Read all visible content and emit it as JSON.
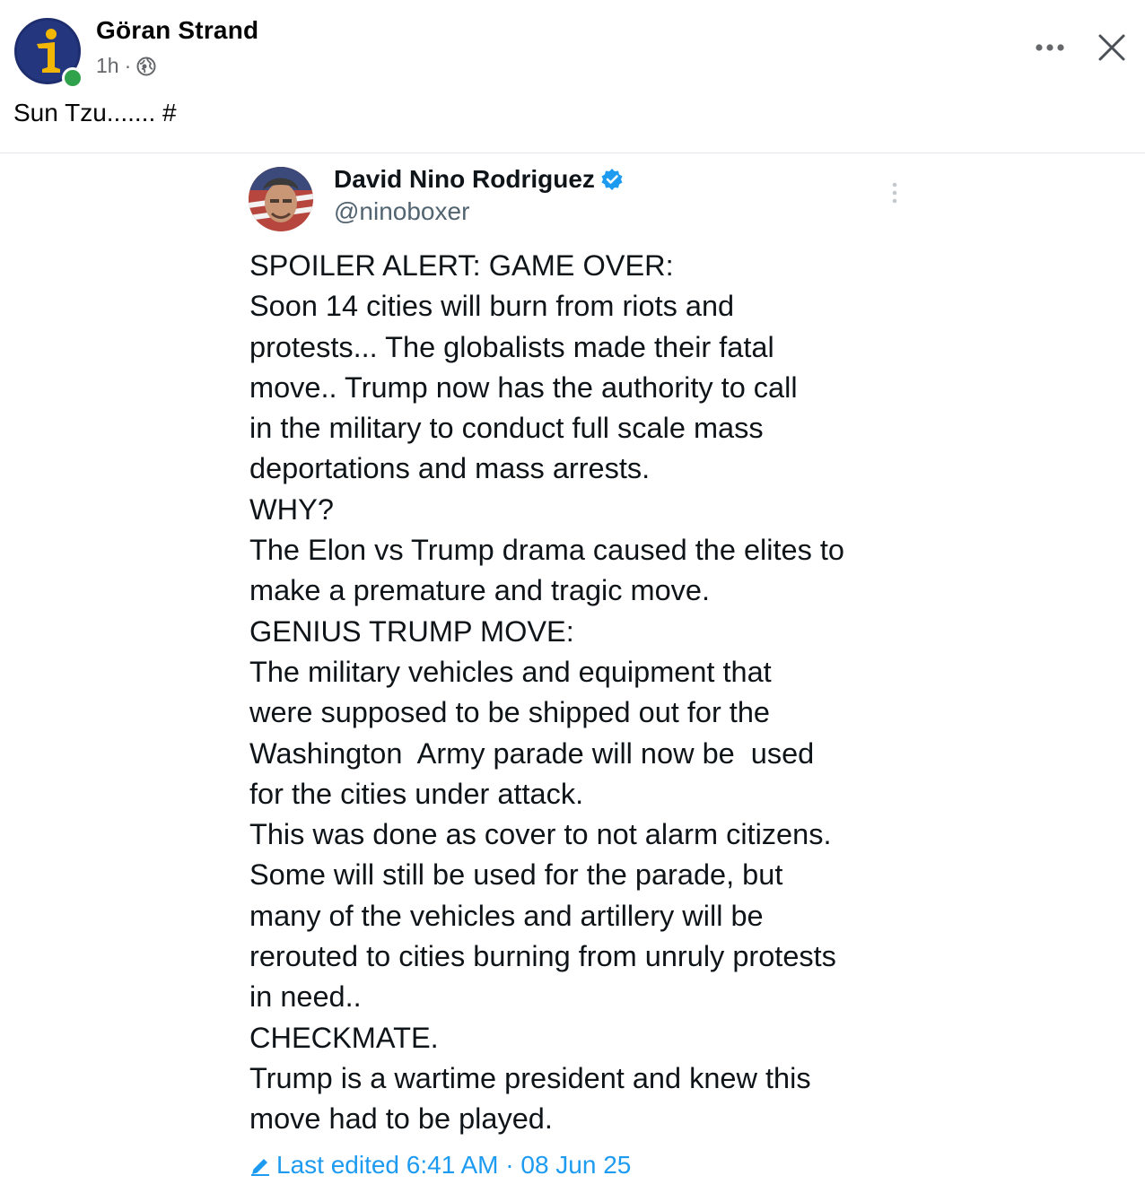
{
  "post": {
    "author_name": "Göran Strand",
    "time": "1h",
    "separator": "·",
    "privacy_icon": "globe-icon",
    "text": "Sun Tzu....... #",
    "more_icon": "more-dots-icon",
    "close_icon": "close-icon"
  },
  "tweet": {
    "display_name": "David Nino Rodriguez",
    "handle": "@ninoboxer",
    "verified_icon": "verified-badge-icon",
    "more_icon": "kebab-icon",
    "lines": [
      "SPOILER ALERT: GAME OVER:",
      "Soon 14 cities will burn from riots and",
      "protests... The globalists made their fatal",
      "move.. Trump now has the authority to call",
      "in the military to conduct full scale mass",
      "deportations and mass arrests.",
      "WHY?",
      "The Elon vs Trump drama caused the elites to",
      "make a premature and tragic move.",
      "GENIUS TRUMP MOVE:",
      "The military vehicles and equipment that",
      "were supposed to be shipped out for the",
      "Washington  Army parade will now be  used",
      "for the cities under attack.",
      "This was done as cover to not alarm citizens.",
      "Some will still be used for the parade, but",
      "many of the vehicles and artillery will be",
      "rerouted to cities burning from unruly protests",
      "in need..",
      "CHECKMATE.",
      "Trump is a wartime president and knew this",
      "move had to be played."
    ],
    "edited_label": "Last edited 6:41 AM · 08 Jun 25"
  },
  "colors": {
    "online": "#31a24c",
    "link_blue": "#1d9bf0",
    "muted": "#65676b"
  }
}
